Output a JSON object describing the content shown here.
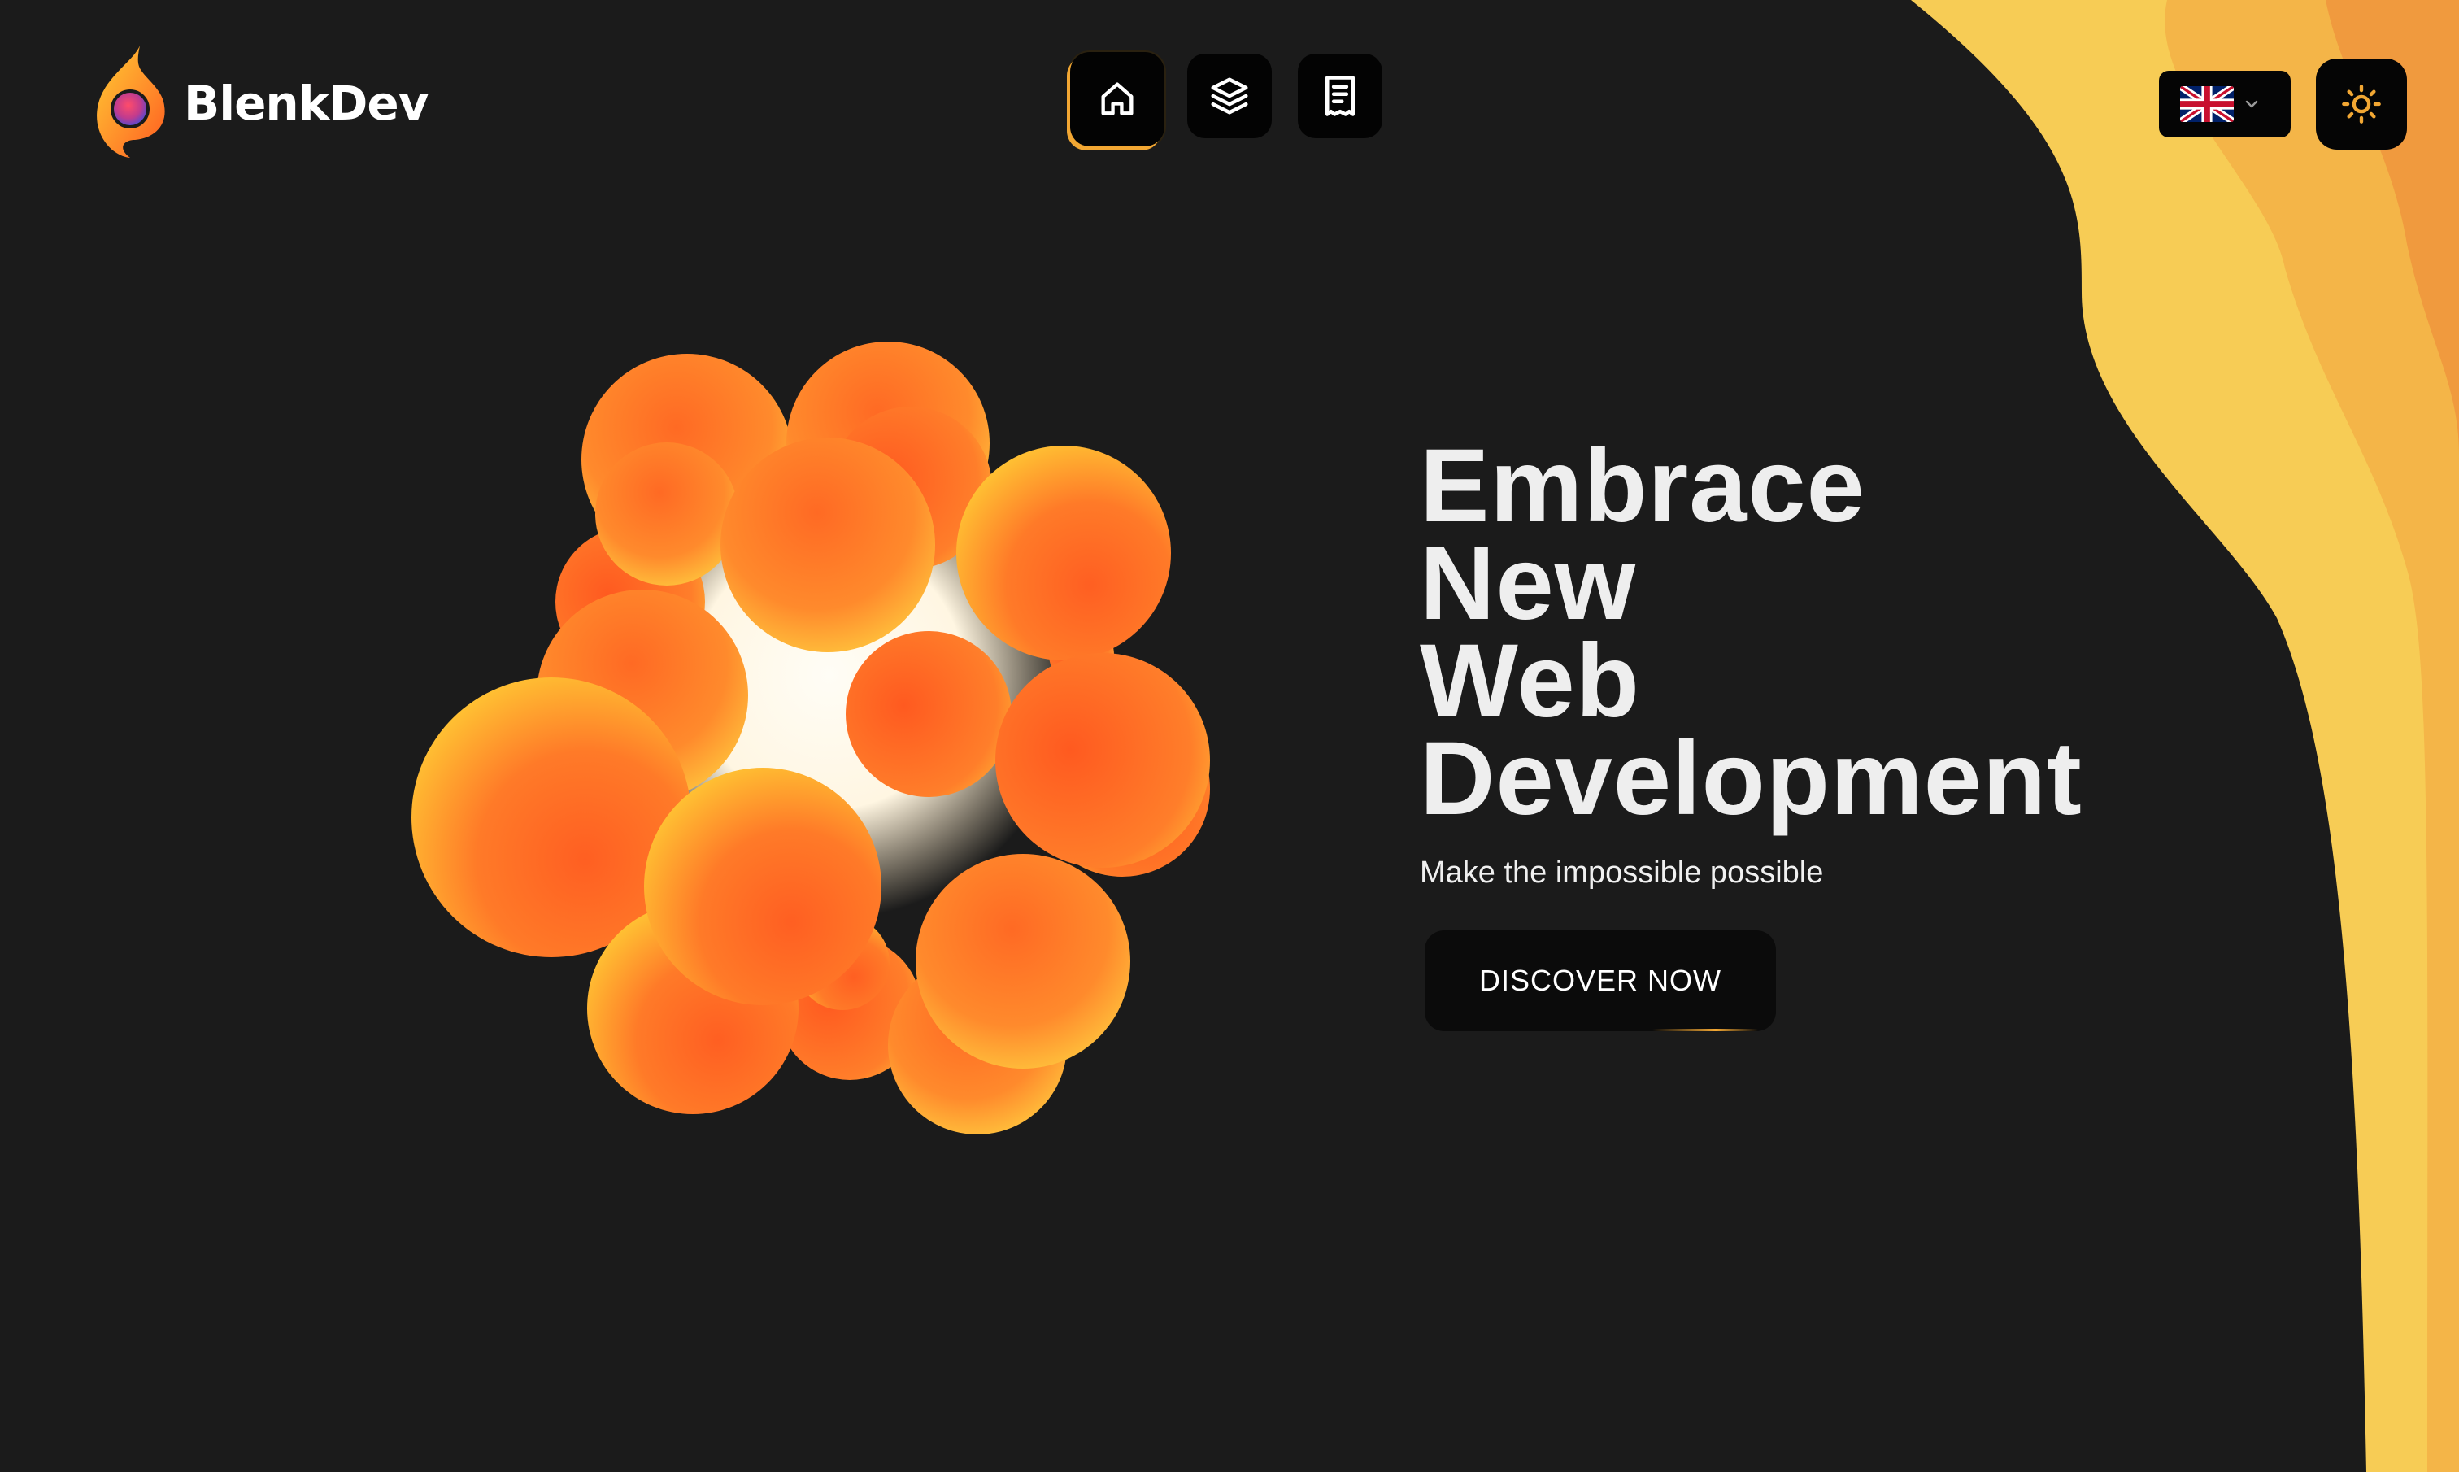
{
  "brand": {
    "name": "BlenkDev",
    "logo_icon": "flame-logo-icon"
  },
  "nav": {
    "items": [
      {
        "icon": "home-icon",
        "active": true
      },
      {
        "icon": "layers-icon",
        "active": false
      },
      {
        "icon": "document-icon",
        "active": false
      }
    ]
  },
  "language": {
    "selected": "en-GB",
    "flag_icon": "uk-flag-icon",
    "dropdown_icon": "chevron-down-icon"
  },
  "theme": {
    "icon": "sun-icon"
  },
  "hero": {
    "title_lines": [
      "Embrace",
      "New",
      "Web",
      "Development"
    ],
    "subtitle": "Make the impossible possible",
    "cta_label": "DISCOVER NOW"
  },
  "colors": {
    "background": "#1b1b1b",
    "accent": "#f2a733",
    "wave_light": "#f7cc55",
    "wave_mid": "#f4b548",
    "wave_dark": "#f09a3e",
    "orb_orange": "#ff6a24",
    "orb_yellow": "#ffc533",
    "text": "#eeeeee"
  }
}
